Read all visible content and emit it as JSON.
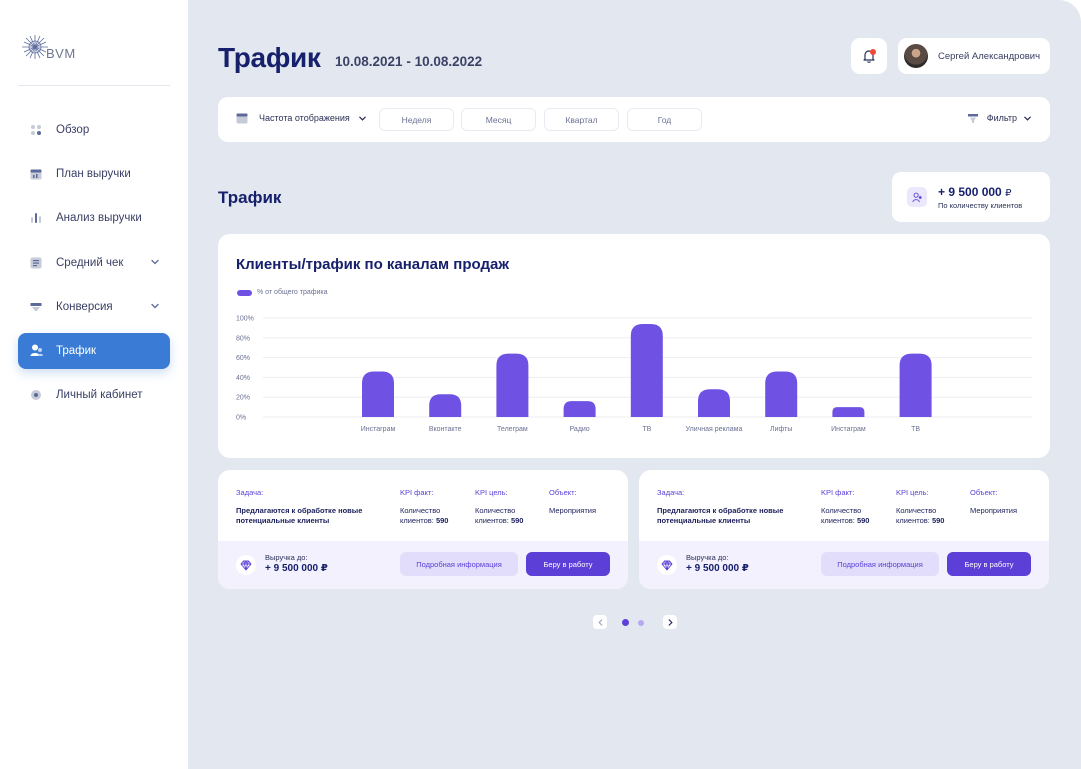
{
  "brand": {
    "name": "BVM"
  },
  "sidebar": {
    "items": [
      {
        "label": "Обзор",
        "icon": "dots-grid-icon",
        "active": false,
        "has_chevron": false
      },
      {
        "label": "План выручки",
        "icon": "calendar-icon",
        "active": false,
        "has_chevron": false
      },
      {
        "label": "Анализ выручки",
        "icon": "bars-icon",
        "active": false,
        "has_chevron": false
      },
      {
        "label": "Средний чек",
        "icon": "receipt-icon",
        "active": false,
        "has_chevron": true
      },
      {
        "label": "Конверсия",
        "icon": "funnel-icon",
        "active": false,
        "has_chevron": true
      },
      {
        "label": "Трафик",
        "icon": "users-icon",
        "active": true,
        "has_chevron": false
      },
      {
        "label": "Личный кабинет",
        "icon": "gear-icon",
        "active": false,
        "has_chevron": false
      }
    ]
  },
  "header": {
    "title": "Трафик",
    "date_range": "10.08.2021 - 10.08.2022",
    "user_name": "Сергей Александрович"
  },
  "toolbar": {
    "frequency_label": "Частота отображения",
    "periods": [
      "Неделя",
      "Месяц",
      "Квартал",
      "Год"
    ],
    "filter_label": "Фильтр"
  },
  "section": {
    "title": "Трафик",
    "kpi_value": "+ 9 500 000",
    "kpi_currency": "₽",
    "kpi_label": "По количеству клиентов"
  },
  "chart_card": {
    "title": "Клиенты/трафик по каналам продаж"
  },
  "chart_data": {
    "type": "bar",
    "categories": [
      "Инстаграм",
      "Вконтакте",
      "Телеграм",
      "Радио",
      "ТВ",
      "Уличная реклама",
      "Лифты",
      "Инстаграм",
      "ТВ"
    ],
    "series": [
      {
        "name": "% от общего трафика",
        "values": [
          46,
          23,
          64,
          16,
          94,
          28,
          46,
          10,
          64
        ]
      }
    ],
    "y_ticks": [
      "0%",
      "20%",
      "40%",
      "60%",
      "80%",
      "100%"
    ],
    "ylim": [
      0,
      100
    ],
    "grid": true,
    "legend": "top-left",
    "colors": {
      "bar": "#6f52e4",
      "grid": "#eceef3"
    }
  },
  "task_cards": [
    {
      "task_label": "Задача:",
      "task_value": "Предлагаются к обработке новые потенциальные клиенты",
      "kpi_fact_label": "KPI факт:",
      "kpi_fact_text": "Количество клиентов:",
      "kpi_fact_value": "590",
      "kpi_goal_label": "KPI цель:",
      "kpi_goal_text": "Количество клиентов:",
      "kpi_goal_value": "590",
      "object_label": "Объект:",
      "object_value": "Мероприятия",
      "revenue_label": "Выручка до:",
      "revenue_value": "+ 9 500 000 ₽",
      "info_button": "Подробная информация",
      "take_button": "Беру в работу"
    },
    {
      "task_label": "Задача:",
      "task_value": "Предлагаются к обработке новые потенциальные клиенты",
      "kpi_fact_label": "KPI факт:",
      "kpi_fact_text": "Количество клиентов:",
      "kpi_fact_value": "590",
      "kpi_goal_label": "KPI цель:",
      "kpi_goal_text": "Количество клиентов:",
      "kpi_goal_value": "590",
      "object_label": "Объект:",
      "object_value": "Мероприятия",
      "revenue_label": "Выручка до:",
      "revenue_value": "+ 9 500 000 ₽",
      "info_button": "Подробная информация",
      "take_button": "Беру в работу"
    }
  ],
  "pager": {
    "pages": 2,
    "current": 1
  },
  "colors": {
    "accent": "#5b3fd6",
    "active_nav": "#3a7bd5",
    "notification": "#f0473c",
    "background": "#e3e8f0"
  }
}
